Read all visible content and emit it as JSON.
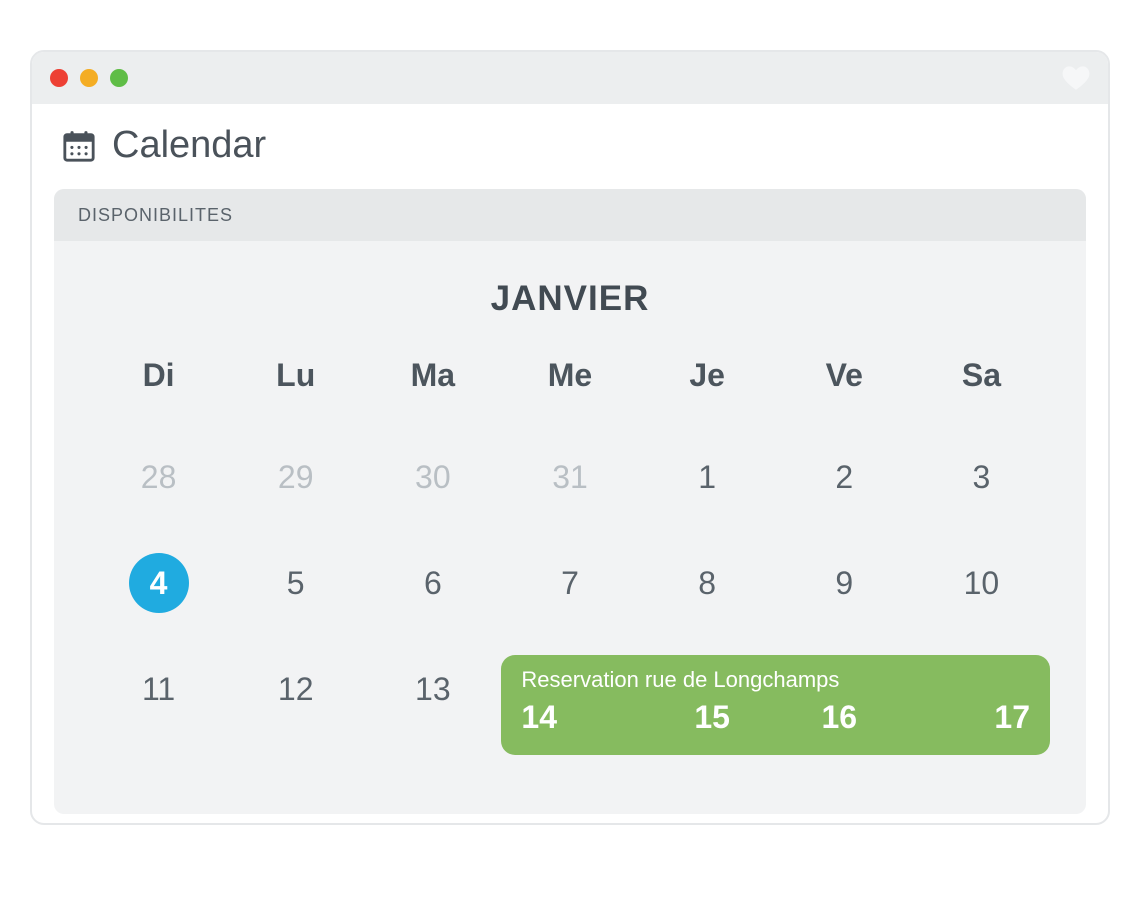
{
  "colors": {
    "traffic_red": "#ed4034",
    "traffic_yellow": "#f4ad24",
    "traffic_green": "#5fbd46",
    "accent_blue": "#20abe0",
    "event_green": "#86bb5f"
  },
  "header": {
    "title": "Calendar"
  },
  "panel": {
    "title": "DISPONIBILITES"
  },
  "calendar": {
    "month_label": "JANVIER",
    "weekdays": [
      "Di",
      "Lu",
      "Ma",
      "Me",
      "Je",
      "Ve",
      "Sa"
    ],
    "rows": [
      [
        {
          "n": "28",
          "other_month": true
        },
        {
          "n": "29",
          "other_month": true
        },
        {
          "n": "30",
          "other_month": true
        },
        {
          "n": "31",
          "other_month": true
        },
        {
          "n": "1"
        },
        {
          "n": "2"
        },
        {
          "n": "3"
        }
      ],
      [
        {
          "n": "4",
          "selected": true
        },
        {
          "n": "5"
        },
        {
          "n": "6"
        },
        {
          "n": "7"
        },
        {
          "n": "8"
        },
        {
          "n": "9"
        },
        {
          "n": "10"
        }
      ],
      [
        {
          "n": "11"
        },
        {
          "n": "12"
        },
        {
          "n": "13"
        },
        {
          "n": "14",
          "in_event": true
        },
        {
          "n": "15",
          "in_event": true
        },
        {
          "n": "16",
          "in_event": true
        },
        {
          "n": "17",
          "in_event": true
        }
      ]
    ],
    "event": {
      "title": "Reservation rue de Longchamps",
      "days": [
        "14",
        "15",
        "16",
        "17"
      ]
    }
  }
}
